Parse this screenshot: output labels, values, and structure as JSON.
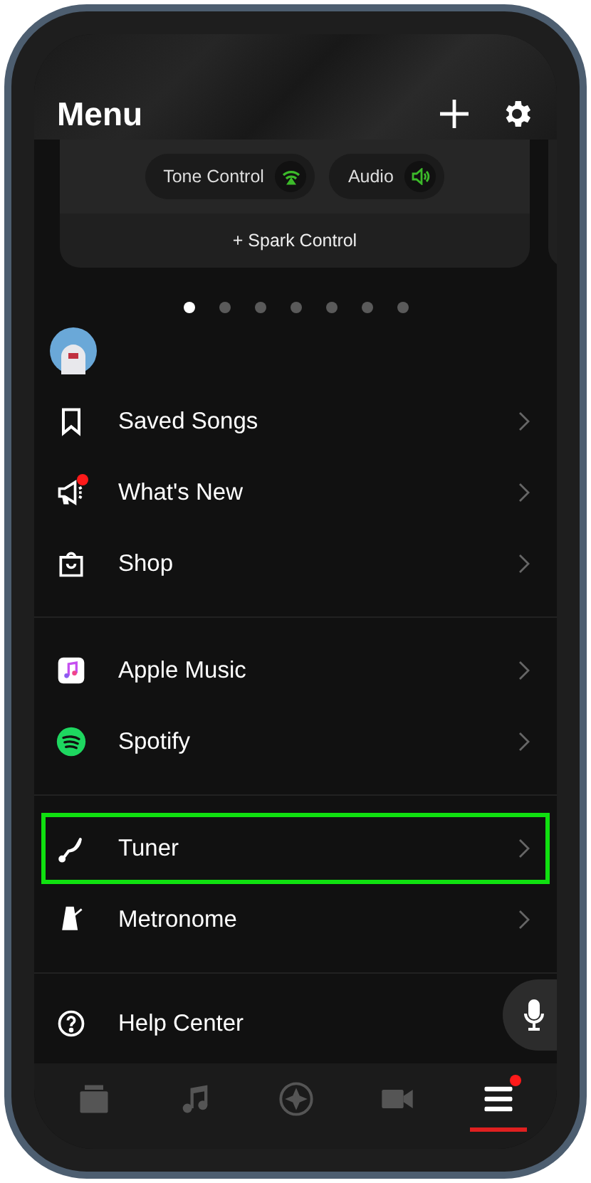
{
  "header": {
    "title": "Menu"
  },
  "device_card": {
    "chips": [
      {
        "label": "Tone Control"
      },
      {
        "label": "Audio"
      }
    ],
    "add_label": "+ Spark Control"
  },
  "carousel_dots": [
    {
      "selected": true
    },
    {
      "selected": false
    },
    {
      "selected": false
    },
    {
      "selected": false
    },
    {
      "selected": false
    },
    {
      "selected": false
    },
    {
      "selected": false
    }
  ],
  "sections": [
    {
      "items": [
        {
          "label": "Saved Songs",
          "badge": false,
          "highlighted": false
        },
        {
          "label": "What's New",
          "badge": true,
          "highlighted": false
        },
        {
          "label": "Shop",
          "badge": false,
          "highlighted": false
        }
      ]
    },
    {
      "items": [
        {
          "label": "Apple Music",
          "badge": false,
          "highlighted": false
        },
        {
          "label": "Spotify",
          "badge": false,
          "highlighted": false
        }
      ]
    },
    {
      "items": [
        {
          "label": "Tuner",
          "badge": false,
          "highlighted": true
        },
        {
          "label": "Metronome",
          "badge": false,
          "highlighted": false
        }
      ]
    },
    {
      "items": [
        {
          "label": "Help Center",
          "badge": false,
          "highlighted": false
        }
      ]
    }
  ],
  "bottom_nav": [
    {
      "selected": false,
      "badge": false
    },
    {
      "selected": false,
      "badge": false
    },
    {
      "selected": false,
      "badge": false
    },
    {
      "selected": false,
      "badge": false
    },
    {
      "selected": true,
      "badge": true
    }
  ]
}
